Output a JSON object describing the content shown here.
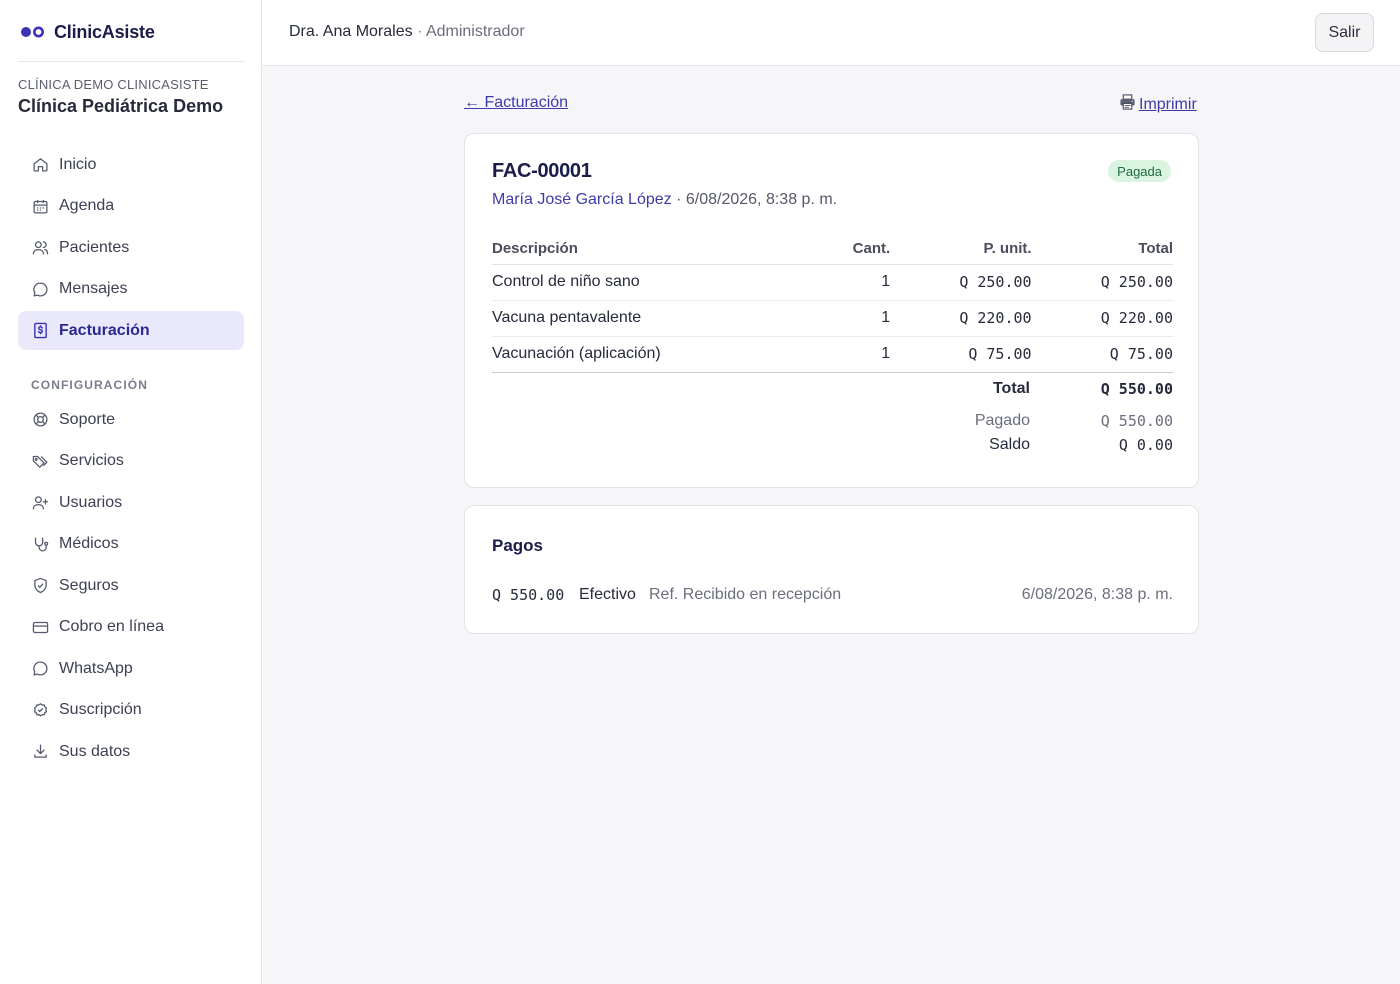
{
  "app": {
    "name": "ClinicAsiste",
    "brand_color": "#3b33b5"
  },
  "clinic": {
    "eyebrow": "CLÍNICA DEMO CLINICASISTE",
    "name": "Clínica Pediátrica Demo"
  },
  "sidebar": {
    "main_items": [
      {
        "label": "Inicio",
        "icon": "home-icon"
      },
      {
        "label": "Agenda",
        "icon": "calendar-icon"
      },
      {
        "label": "Pacientes",
        "icon": "users-icon"
      },
      {
        "label": "Mensajes",
        "icon": "message-icon"
      },
      {
        "label": "Facturación",
        "icon": "invoice-icon",
        "active": true
      }
    ],
    "config_label": "CONFIGURACIÓN",
    "config_items": [
      {
        "label": "Soporte",
        "icon": "lifebuoy-icon"
      },
      {
        "label": "Servicios",
        "icon": "tags-icon"
      },
      {
        "label": "Usuarios",
        "icon": "user-plus-icon"
      },
      {
        "label": "Médicos",
        "icon": "stethoscope-icon"
      },
      {
        "label": "Seguros",
        "icon": "shield-icon"
      },
      {
        "label": "Cobro en línea",
        "icon": "credit-card-icon"
      },
      {
        "label": "WhatsApp",
        "icon": "chat-icon"
      },
      {
        "label": "Suscripción",
        "icon": "badge-check-icon"
      },
      {
        "label": "Sus datos",
        "icon": "download-icon"
      }
    ]
  },
  "header": {
    "user_name": "Dra. Ana Morales",
    "separator": "·",
    "user_role": "Administrador",
    "logout_label": "Salir"
  },
  "nav_links": {
    "back_label": "← Facturación",
    "print_label": "Imprimir"
  },
  "invoice": {
    "number": "FAC-00001",
    "status": "Pagada",
    "patient": "María José García López",
    "separator": "·",
    "date": "6/08/2026, 8:38 p. m.",
    "columns": {
      "description": "Descripción",
      "quantity": "Cant.",
      "unit_price": "P. unit.",
      "total": "Total"
    },
    "items": [
      {
        "description": "Control de niño sano",
        "quantity": "1",
        "unit_price": "Q 250.00",
        "total": "Q 250.00"
      },
      {
        "description": "Vacuna pentavalente",
        "quantity": "1",
        "unit_price": "Q 220.00",
        "total": "Q 220.00"
      },
      {
        "description": "Vacunación (aplicación)",
        "quantity": "1",
        "unit_price": "Q 75.00",
        "total": "Q 75.00"
      }
    ],
    "total_label": "Total",
    "total_value": "Q 550.00",
    "paid_label": "Pagado",
    "paid_value": "Q 550.00",
    "balance_label": "Saldo",
    "balance_value": "Q 0.00"
  },
  "payments": {
    "title": "Pagos",
    "rows": [
      {
        "amount": "Q 550.00",
        "method": "Efectivo",
        "reference": "Ref. Recibido en recepción",
        "date": "6/08/2026, 8:38 p. m."
      }
    ]
  }
}
